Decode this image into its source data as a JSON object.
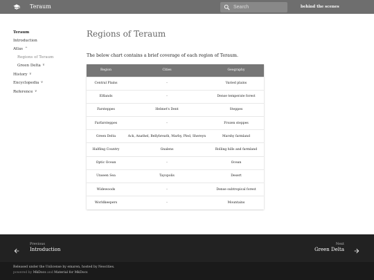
{
  "header": {
    "site_title": "Teraum",
    "search_placeholder": "Search",
    "link_label": "behind the scenes",
    "logo_icon": "graduation-cap-icon",
    "search_icon": "magnifier-icon"
  },
  "nav": {
    "title": "Teraum",
    "items": [
      {
        "label": "Introduction",
        "chevron": ""
      },
      {
        "label": "Atlas",
        "chevron": "^"
      },
      {
        "label": "Regions of Teraum",
        "chevron": ""
      },
      {
        "label": "Green Delta",
        "chevron": "v"
      },
      {
        "label": "History",
        "chevron": "v"
      },
      {
        "label": "Encyclopedia",
        "chevron": "v"
      },
      {
        "label": "Reference",
        "chevron": "v"
      }
    ]
  },
  "main": {
    "title": "Regions of Teraum",
    "intro": "The below chart contains a brief coverage of each region of Teraum.",
    "table": {
      "headers": [
        "Region",
        "Cities",
        "Geography"
      ],
      "rows": [
        [
          "Central Plains",
          "-",
          "Varied plains"
        ],
        [
          "Elflands",
          "-",
          "Dense temperate forest"
        ],
        [
          "Farsteppes",
          "Helmet's Dent",
          "Steppes"
        ],
        [
          "Farfarsteppes",
          "-",
          "Frozen steppes"
        ],
        [
          "Green Delta",
          "Ack, Anathel, Bellybreath, Marby, Pled, Shereyn",
          "Marshy farmland"
        ],
        [
          "Halfling Country",
          "Gnalens",
          "Rolling hills and farmland"
        ],
        [
          "Optic Ocean",
          "-",
          "Ocean"
        ],
        [
          "Unseen Sea",
          "Tayopolis",
          "Desert"
        ],
        [
          "Widewoods",
          "-",
          "Dense subtropical forest"
        ],
        [
          "Worldkeepers",
          "-",
          "Mountains"
        ]
      ]
    }
  },
  "footer": {
    "prev_caption": "Previous",
    "prev_label": "Introduction",
    "next_caption": "Next",
    "next_label": "Green Delta",
    "prev_icon": "arrow-left-icon",
    "next_icon": "arrow-right-icon"
  },
  "meta": {
    "line1": "Released under the Unlicense by emaren, hosted by Neocities.",
    "powered_prefix": "powered by",
    "powered_link1": "MkDocs",
    "powered_and": "and",
    "powered_link2": "Material for MkDocs"
  },
  "colors": {
    "header_bg": "#6e6e6e",
    "table_head_bg": "#767676",
    "footer_bg": "#222222",
    "footer_meta_bg": "#1a1a1a"
  }
}
